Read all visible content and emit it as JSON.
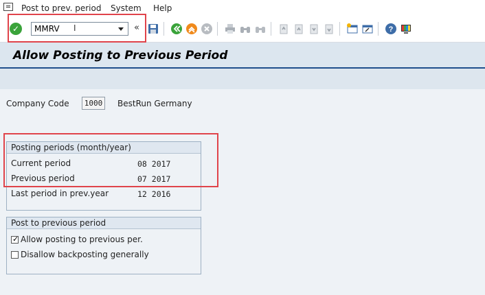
{
  "menubar": {
    "items": [
      "Post to prev. period",
      "System",
      "Help"
    ]
  },
  "toolbar": {
    "command_value": "MMRV",
    "icons": [
      "ok-icon",
      "back-icon",
      "exit-icon",
      "cancel-icon",
      "save-icon",
      "print-icon",
      "find-icon",
      "first-page-icon",
      "previous-page-icon",
      "next-page-icon",
      "last-page-icon",
      "new-session-icon",
      "shortcut-icon",
      "help-icon",
      "layout-icon"
    ]
  },
  "page": {
    "title": "Allow Posting to Previous Period"
  },
  "company": {
    "label": "Company Code",
    "code": "1000",
    "name": "BestRun Germany"
  },
  "periods": {
    "title": "Posting periods (month/year)",
    "rows": [
      {
        "label": "Current period",
        "value": "08 2017"
      },
      {
        "label": "Previous period",
        "value": "07 2017"
      },
      {
        "label": "Last period in prev.year",
        "value": "12 2016"
      }
    ]
  },
  "prev_posting": {
    "title": "Post to previous period",
    "options": [
      {
        "label": "Allow posting to previous per.",
        "checked": true
      },
      {
        "label": "Disallow backposting generally",
        "checked": false
      }
    ]
  },
  "colors": {
    "highlight": "#e0434a",
    "title_underline": "#1f4e8c"
  }
}
